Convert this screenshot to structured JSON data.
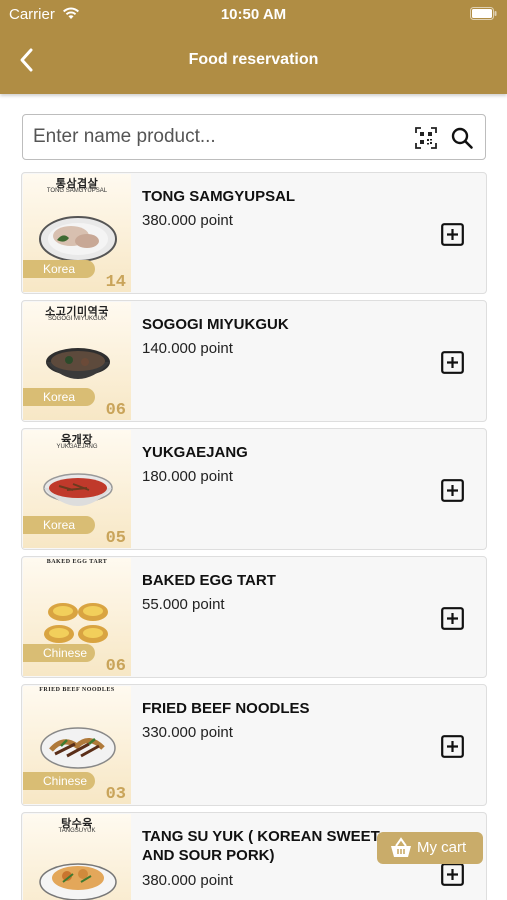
{
  "status_bar": {
    "carrier": "Carrier",
    "time": "10:50 AM"
  },
  "header": {
    "title": "Food reservation"
  },
  "search": {
    "placeholder": "Enter name product..."
  },
  "products": [
    {
      "name": "TONG SAMGYUPSAL",
      "price": "380.000 point",
      "thumb_title": "통삼겹살",
      "thumb_sub": "TONG SAMGYUPSAL",
      "region": "Korea",
      "number": "14"
    },
    {
      "name": "SOGOGI MIYUKGUK",
      "price": "140.000 point",
      "thumb_title": "소고기미역국",
      "thumb_sub": "SOGOGI MIYUKGUK",
      "region": "Korea",
      "number": "06"
    },
    {
      "name": "YUKGAEJANG",
      "price": "180.000 point",
      "thumb_title": "육개장",
      "thumb_sub": "YUKGAEJANG",
      "region": "Korea",
      "number": "05"
    },
    {
      "name": "BAKED EGG TART",
      "price": "55.000 point",
      "thumb_title": "BAKED EGG TART",
      "thumb_sub": "",
      "region": "Chinese",
      "number": "06"
    },
    {
      "name": "FRIED BEEF NOODLES",
      "price": "330.000 point",
      "thumb_title": "FRIED BEEF NOODLES",
      "thumb_sub": "",
      "region": "Chinese",
      "number": "03"
    },
    {
      "name": "TANG SU YUK ( KOREAN SWEET AND SOUR PORK)",
      "price": "380.000 point",
      "thumb_title": "탕수육",
      "thumb_sub": "TANGSUYUK",
      "region": "",
      "number": ""
    }
  ],
  "cart": {
    "label": "My cart"
  },
  "colors": {
    "brand": "#b08d44",
    "tag": "#d9bd74",
    "cart": "#c9ac6a"
  },
  "icons": {
    "back": "chevron-left-icon",
    "qr": "qr-scan-icon",
    "search": "search-icon",
    "add": "plus-square-icon",
    "cart": "basket-icon"
  }
}
